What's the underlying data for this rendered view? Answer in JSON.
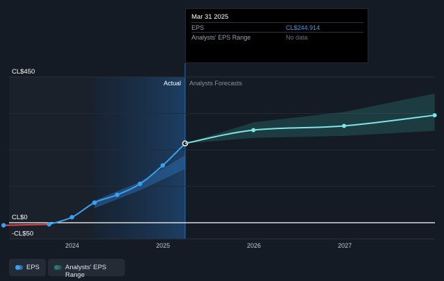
{
  "chart_data": {
    "type": "line",
    "x_ticks": [
      "2024",
      "2025",
      "2026",
      "2027"
    ],
    "y_ticks": [
      {
        "label": "CL$450",
        "value": 450
      },
      {
        "label": "CL$0",
        "value": 0
      },
      {
        "label": "-CL$50",
        "value": -50
      }
    ],
    "ylim": [
      -50,
      450
    ],
    "divider_label_left": "Actual",
    "divider_label_right": "Analysts Forecasts",
    "series": [
      {
        "name": "EPS",
        "color": "#3aa0f0",
        "negative_color": "#e0474c",
        "points": [
          {
            "x": "2023-03-31",
            "y": -8
          },
          {
            "x": "2023-09-30",
            "y": -5
          },
          {
            "x": "2023-12-31",
            "y": 17
          },
          {
            "x": "2024-03-31",
            "y": 62
          },
          {
            "x": "2024-06-30",
            "y": 86
          },
          {
            "x": "2024-09-30",
            "y": 120
          },
          {
            "x": "2024-12-31",
            "y": 177
          },
          {
            "x": "2025-03-31",
            "y": 244.914
          }
        ]
      },
      {
        "name": "EPS forecast",
        "color": "#7fe6e6",
        "points": [
          {
            "x": "2025-03-31",
            "y": 244.914
          },
          {
            "x": "2025-12-31",
            "y": 286
          },
          {
            "x": "2026-12-31",
            "y": 299
          },
          {
            "x": "2027-12-31",
            "y": 332
          }
        ]
      }
    ],
    "ranges": [
      {
        "name": "Analysts' EPS Range (past)",
        "color": "#2b67a8",
        "points": [
          {
            "x": "2024-03-31",
            "lo": 45,
            "hi": 68
          },
          {
            "x": "2024-09-30",
            "lo": 100,
            "hi": 126
          },
          {
            "x": "2025-03-31",
            "lo": 166,
            "hi": 208
          }
        ]
      },
      {
        "name": "Analysts' EPS Range (forecast)",
        "color": "#2a7a78",
        "points": [
          {
            "x": "2025-03-31",
            "lo": 244.914,
            "hi": 244.914
          },
          {
            "x": "2025-12-31",
            "lo": 262,
            "hi": 310
          },
          {
            "x": "2026-12-31",
            "lo": 268,
            "hi": 342
          },
          {
            "x": "2027-12-31",
            "lo": 284,
            "hi": 399
          }
        ]
      }
    ],
    "highlight_x": "2025-03-31"
  },
  "tooltip": {
    "date": "Mar 31 2025",
    "rows": [
      {
        "label": "EPS",
        "value": "CL$244.914",
        "color": "#3aa0f0"
      },
      {
        "label": "Analysts' EPS Range",
        "value": "No data",
        "color": "#6b7280"
      }
    ]
  },
  "legend": [
    {
      "label": "EPS",
      "color": "#3aa0f0"
    },
    {
      "label": "Analysts' EPS Range",
      "color": "#2a7a78"
    }
  ]
}
